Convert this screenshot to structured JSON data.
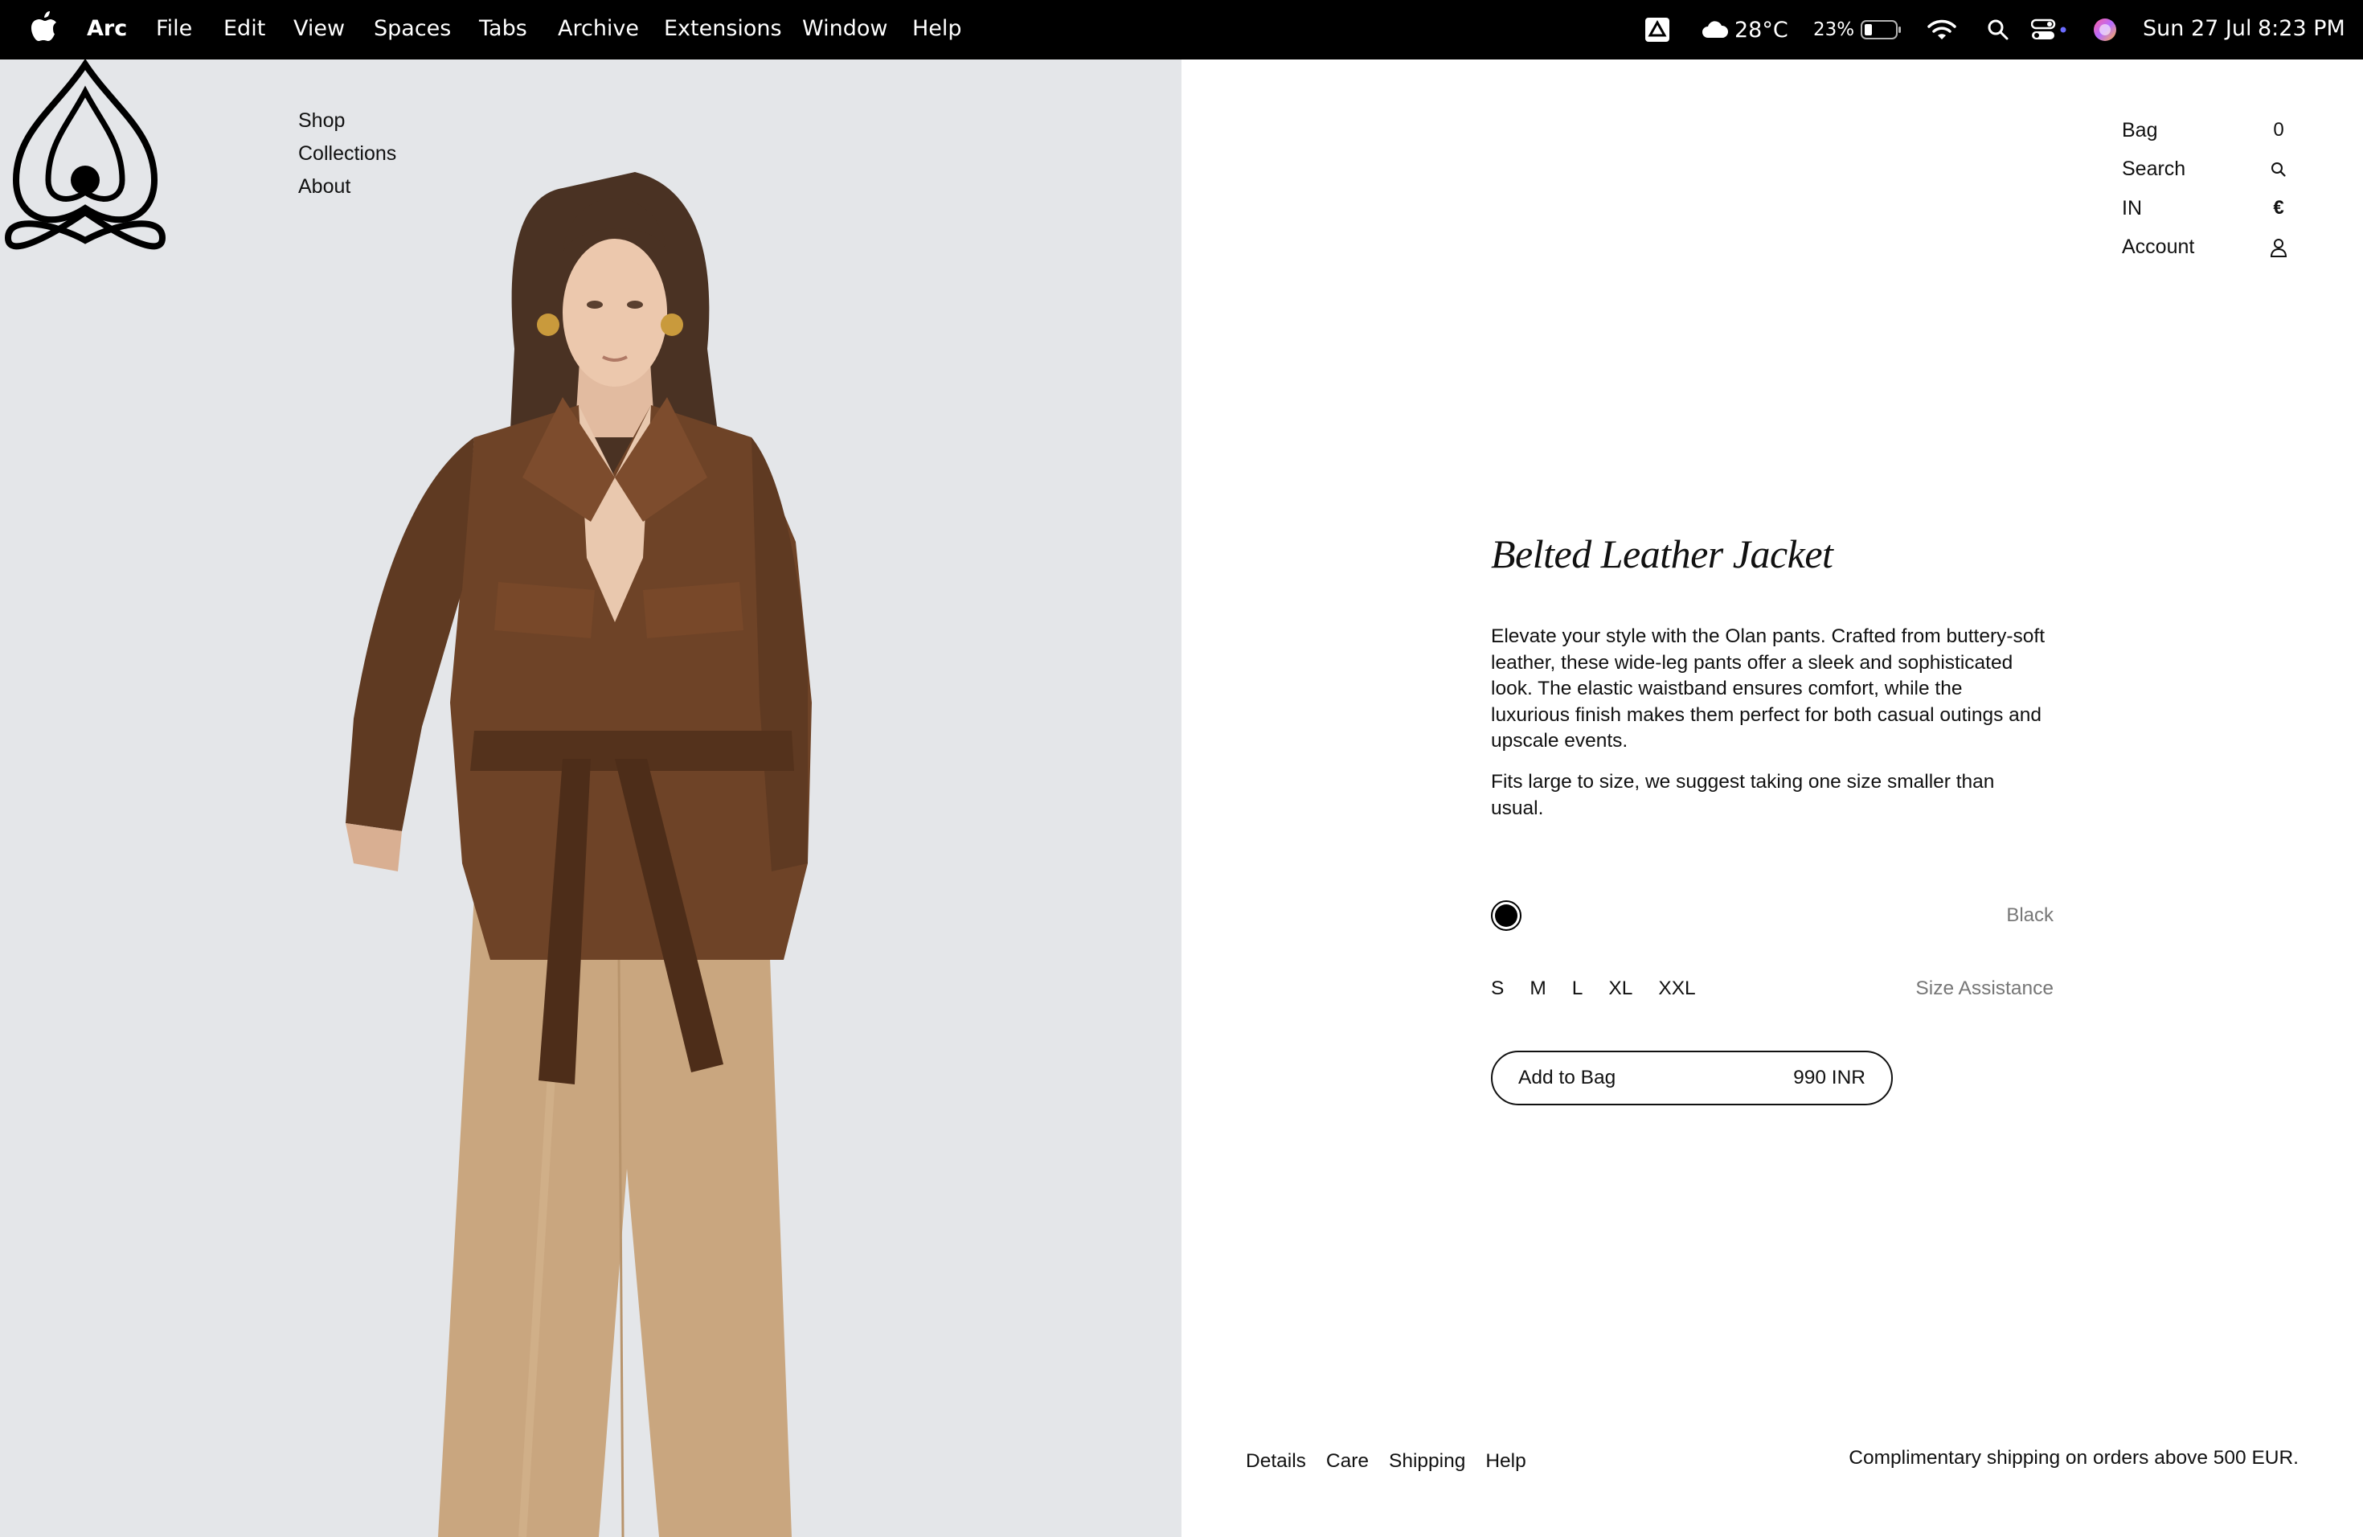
{
  "menubar": {
    "app_name": "Arc",
    "items": [
      "File",
      "Edit",
      "View",
      "Spaces",
      "Tabs",
      "Archive",
      "Extensions",
      "Window",
      "Help"
    ],
    "weather": "28°C",
    "battery": "23%",
    "date": "Sun 27 Jul",
    "time": "8:23 PM"
  },
  "main_nav": {
    "items": [
      "Shop",
      "Collections",
      "About"
    ]
  },
  "util_nav": {
    "bag_label": "Bag",
    "bag_count": "0",
    "search_label": "Search",
    "region_label": "IN",
    "currency_symbol": "€",
    "account_label": "Account"
  },
  "product": {
    "title": "Belted Leather Jacket",
    "description": "Elevate your style with the Olan pants. Crafted from buttery-soft leather, these wide-leg pants offer a sleek and sophisticated look. The elastic waistband ensures comfort, while the luxurious finish makes them perfect for both casual outings and upscale events.",
    "fit_note": "Fits large to size, we suggest taking one size smaller than usual.",
    "color_name": "Black",
    "color_swatch": "#000000",
    "sizes": [
      "S",
      "M",
      "L",
      "XL",
      "XXL"
    ],
    "size_assistance_label": "Size Assistance",
    "add_to_bag_label": "Add to Bag",
    "price": "990 INR"
  },
  "footer": {
    "links": [
      "Details",
      "Care",
      "Shipping",
      "Help"
    ],
    "shipping_note": "Complimentary shipping on orders above 500 EUR."
  },
  "colors": {
    "jacket": "#6e4327",
    "pants": "#c9a67f",
    "photo_bg": "#e4e6e9"
  }
}
